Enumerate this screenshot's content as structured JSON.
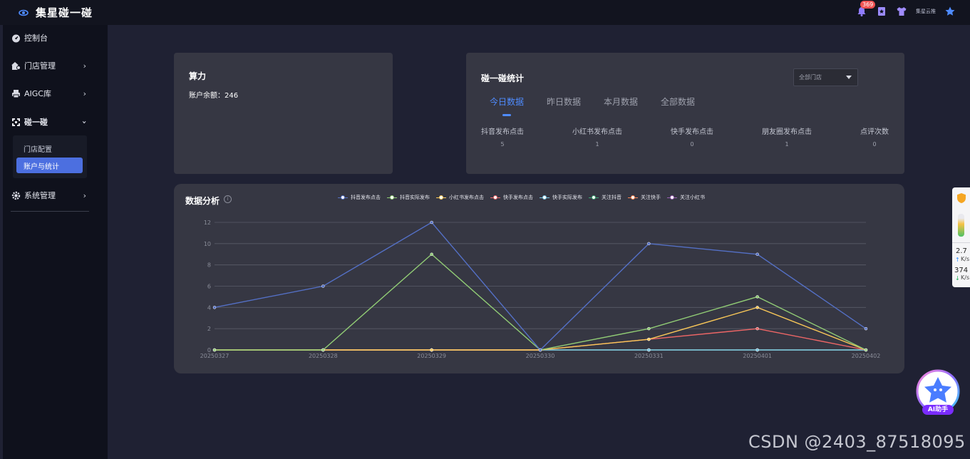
{
  "app": {
    "title": "集星碰一碰"
  },
  "header": {
    "notification_count": "369",
    "user_label": "集星云推"
  },
  "sidebar": {
    "items": [
      {
        "label": "控制台",
        "icon": "dashboard-icon"
      },
      {
        "label": "门店管理",
        "icon": "store-icon"
      },
      {
        "label": "AIGC库",
        "icon": "printer-icon"
      },
      {
        "label": "碰一碰",
        "icon": "nfc-icon"
      },
      {
        "label": "系统管理",
        "icon": "gear-icon"
      }
    ],
    "submenu": [
      {
        "label": "门店配置"
      },
      {
        "label": "账户与统计"
      }
    ]
  },
  "power_card": {
    "title": "算力",
    "balance_label": "账户余额：",
    "balance_value": "246"
  },
  "stats_card": {
    "title": "碰一碰统计",
    "store_select": "全部门店",
    "tabs": [
      "今日数据",
      "昨日数据",
      "本月数据",
      "全部数据"
    ],
    "active_tab": 0,
    "stats": [
      {
        "label": "抖音发布点击",
        "value": "5"
      },
      {
        "label": "小红书发布点击",
        "value": "1"
      },
      {
        "label": "快手发布点击",
        "value": "0"
      },
      {
        "label": "朋友圈发布点击",
        "value": "1"
      },
      {
        "label": "点评次数",
        "value": "0"
      }
    ]
  },
  "analysis": {
    "title": "数据分析",
    "info_icon": "info-icon"
  },
  "chart_data": {
    "type": "line",
    "x": [
      "20250327",
      "20250328",
      "20250329",
      "20250330",
      "20250331",
      "20250401",
      "20250402"
    ],
    "ylim": [
      0,
      12
    ],
    "yticks": [
      "0",
      "2",
      "4",
      "6",
      "8",
      "10",
      "12"
    ],
    "grid": true,
    "legend_position": "top",
    "series": [
      {
        "name": "抖音发布点击",
        "color": "#5470c6",
        "values": [
          4,
          6,
          12,
          0,
          10,
          9,
          2
        ]
      },
      {
        "name": "抖音实际发布",
        "color": "#91cc75",
        "values": [
          0,
          0,
          9,
          0,
          2,
          5,
          0
        ]
      },
      {
        "name": "小红书发布点击",
        "color": "#fac858",
        "values": [
          0,
          0,
          0,
          0,
          1,
          4,
          0
        ]
      },
      {
        "name": "快手发布点击",
        "color": "#ee6666",
        "values": [
          0,
          0,
          0,
          0,
          1,
          2,
          0
        ]
      },
      {
        "name": "快手实际发布",
        "color": "#73c0de",
        "values": [
          0,
          0,
          0,
          0,
          0,
          0,
          0
        ]
      },
      {
        "name": "关注抖音",
        "color": "#3ba272",
        "values": [
          0,
          0,
          0,
          0,
          0,
          0,
          0
        ]
      },
      {
        "name": "关注快手",
        "color": "#fc8452",
        "values": [
          0,
          0,
          0,
          0,
          0,
          0,
          0
        ]
      },
      {
        "name": "关注小红书",
        "color": "#9a60b4",
        "values": [
          0,
          0,
          0,
          0,
          0,
          0,
          0
        ]
      }
    ]
  },
  "float_widget": {
    "up_speed": "2.7",
    "down_speed": "374",
    "unit": "K/s"
  },
  "ai_assistant": {
    "label": "AI助手"
  },
  "watermark": "CSDN @2403_87518095"
}
